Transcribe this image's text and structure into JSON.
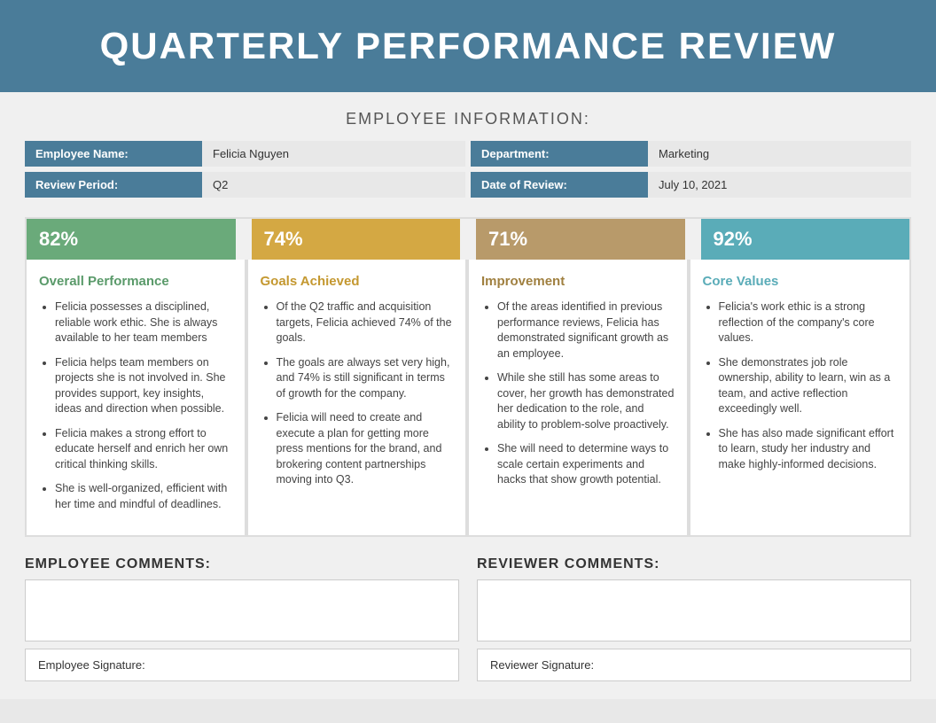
{
  "header": {
    "title": "QUARTERLY PERFORMANCE REVIEW"
  },
  "employee_info": {
    "section_title": "EMPLOYEE INFORMATION:",
    "fields": [
      {
        "label": "Employee Name:",
        "value": "Felicia Nguyen"
      },
      {
        "label": "Department:",
        "value": "Marketing"
      },
      {
        "label": "Review Period:",
        "value": "Q2"
      },
      {
        "label": "Date of Review:",
        "value": "July 10, 2021"
      }
    ]
  },
  "metrics": [
    {
      "value": "82%",
      "color": "green"
    },
    {
      "value": "74%",
      "color": "yellow"
    },
    {
      "value": "71%",
      "color": "tan"
    },
    {
      "value": "92%",
      "color": "teal"
    }
  ],
  "columns": [
    {
      "title": "Overall Performance",
      "title_color": "green",
      "items": [
        "Felicia possesses a disciplined, reliable work ethic. She is always available to her team members",
        "Felicia helps team members on projects she is not involved in. She provides support, key insights, ideas and direction when possible.",
        "Felicia makes a strong effort to educate herself and enrich her own critical thinking skills.",
        "She is well-organized, efficient with her time and mindful of deadlines."
      ]
    },
    {
      "title": "Goals Achieved",
      "title_color": "yellow",
      "items": [
        "Of the Q2 traffic and acquisition targets, Felicia achieved 74% of the goals.",
        "The goals are always set very high, and 74% is still significant in terms of growth for the company.",
        "Felicia will need to create and execute a plan for getting more press mentions for the brand, and brokering content partnerships moving into Q3."
      ]
    },
    {
      "title": "Improvement",
      "title_color": "tan",
      "items": [
        "Of the areas identified in previous performance reviews, Felicia has demonstrated significant growth as an employee.",
        "While she still has some areas to cover, her growth has demonstrated her dedication to the role, and ability to problem-solve proactively.",
        "She will need to determine ways to scale certain experiments and hacks that show growth potential."
      ]
    },
    {
      "title": "Core Values",
      "title_color": "teal",
      "items": [
        "Felicia's work ethic is a strong reflection of the company's core values.",
        "She demonstrates job role ownership, ability to learn, win as a team, and active reflection exceedingly well.",
        "She has also made significant effort to learn, study her industry and make highly-informed decisions."
      ]
    }
  ],
  "bottom": {
    "employee_comments_label": "EMPLOYEE COMMENTS:",
    "reviewer_comments_label": "REVIEWER COMMENTS:",
    "employee_signature_label": "Employee Signature:",
    "reviewer_signature_label": "Reviewer Signature:"
  }
}
